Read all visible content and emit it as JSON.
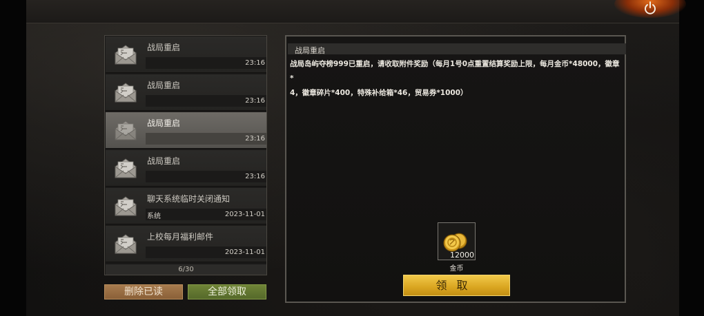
{
  "mail_list": {
    "items": [
      {
        "title": "战局重启",
        "sender": "",
        "time": "23:16",
        "selected": false
      },
      {
        "title": "战局重启",
        "sender": "",
        "time": "23:16",
        "selected": false
      },
      {
        "title": "战局重启",
        "sender": "",
        "time": "23:16",
        "selected": true
      },
      {
        "title": "战局重启",
        "sender": "",
        "time": "23:16",
        "selected": false
      },
      {
        "title": "聊天系统临时关闭通知",
        "sender": "系统",
        "time": "2023-11-01",
        "selected": false
      },
      {
        "title": "上校每月福利邮件",
        "sender": "",
        "time": "2023-11-01",
        "selected": false
      }
    ],
    "page_indicator": "6/30"
  },
  "buttons": {
    "delete_read": "删除已读",
    "collect_all": "全部领取",
    "claim": "领取"
  },
  "detail": {
    "title": "战局重启",
    "body_line1": "战局岛屿夺榜999已重启，请收取附件奖励（每月1号0点重置结算奖励上限，每月金币*48000，徽章*",
    "body_line2": "4，徽章碎片*400，特殊补给箱*46，贸易券*1000）",
    "attachment": {
      "name": "金币",
      "quantity": "12000",
      "icon": "gold-coin-icon"
    }
  },
  "icons": {
    "power": "power-icon",
    "mail": "envelope-icon"
  },
  "colors": {
    "claim_button": "#d9a520",
    "delete_button": "#8a6038",
    "collect_all_button": "#55692a",
    "power_glow": "#e06a1a"
  }
}
